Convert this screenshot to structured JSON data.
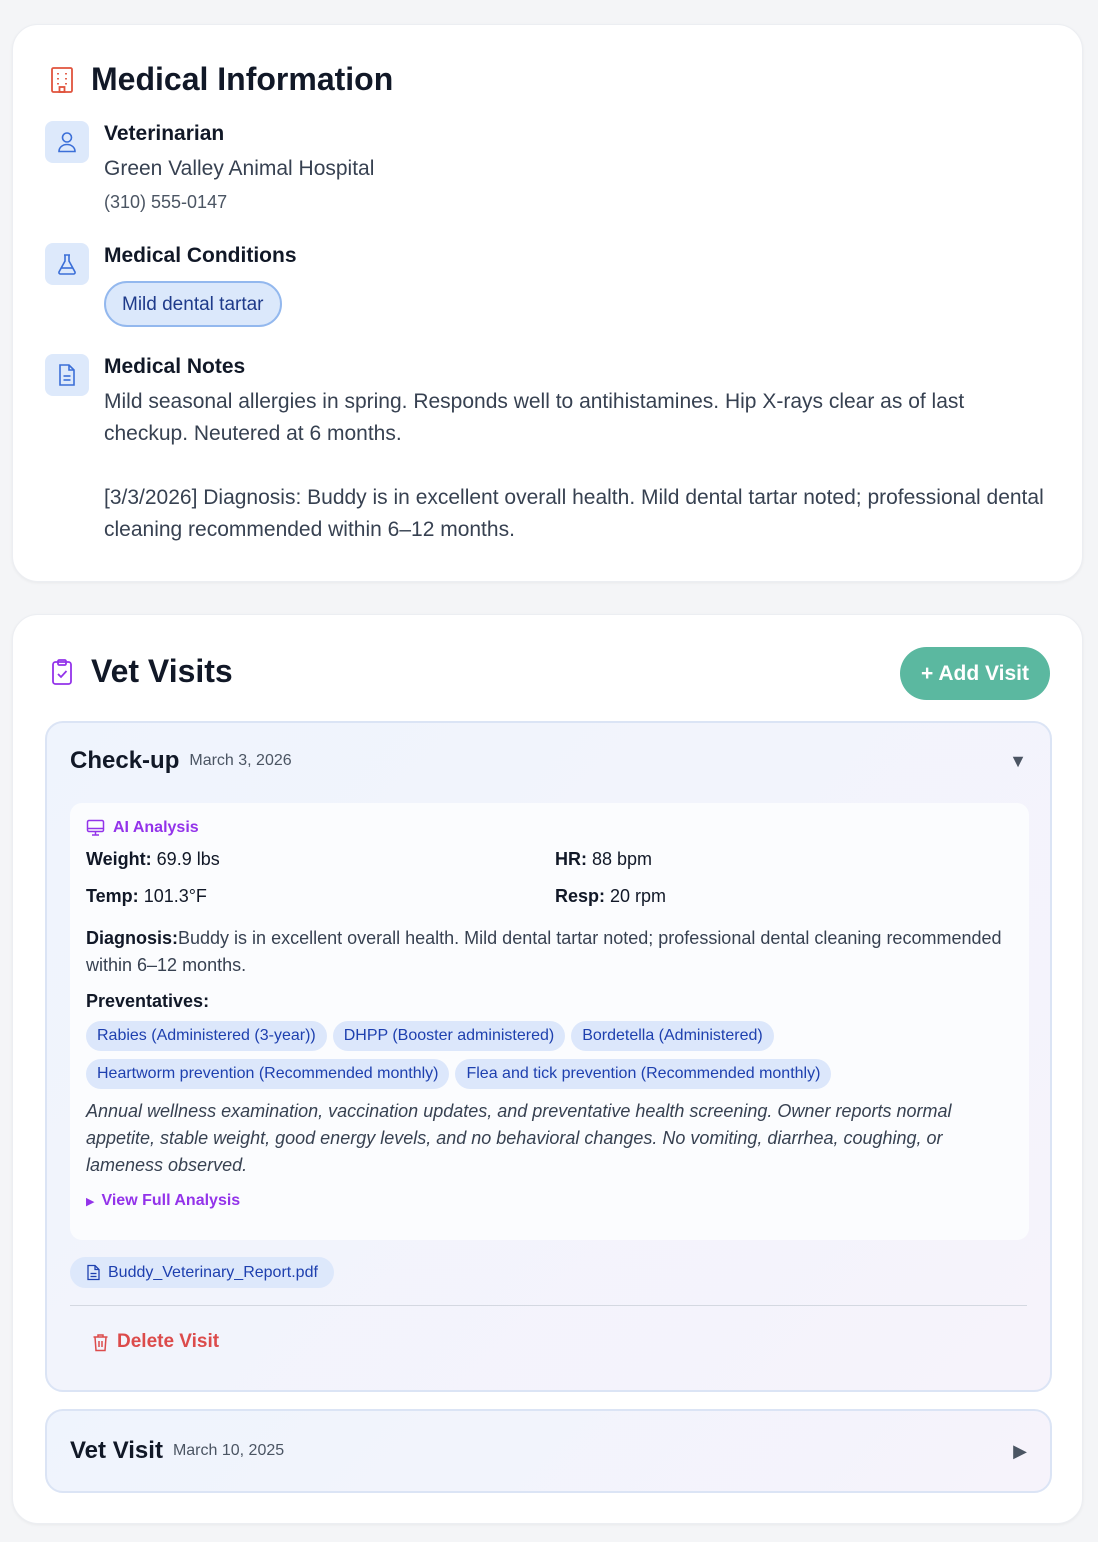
{
  "medical": {
    "title": "Medical Information",
    "veterinarian": {
      "label": "Veterinarian",
      "name": "Green Valley Animal Hospital",
      "phone": "(310) 555-0147"
    },
    "conditions": {
      "label": "Medical Conditions",
      "items": [
        "Mild dental tartar"
      ]
    },
    "notes": {
      "label": "Medical Notes",
      "paragraph1": "Mild seasonal allergies in spring. Responds well to antihistamines. Hip X-rays clear as of last checkup. Neutered at 6 months.",
      "paragraph2": "[3/3/2026] Diagnosis: Buddy is in excellent overall health. Mild dental tartar noted; professional dental cleaning recommended within 6–12 months."
    }
  },
  "visits": {
    "title": "Vet Visits",
    "add_label": "+ Add Visit",
    "items": [
      {
        "title": "Check-up",
        "date": "March 3, 2026",
        "expanded_indicator": "▼",
        "analysis": {
          "label": "AI Analysis",
          "weight_label": "Weight:",
          "weight": "69.9 lbs",
          "hr_label": "HR:",
          "hr": "88 bpm",
          "temp_label": "Temp:",
          "temp": "101.3°F",
          "resp_label": "Resp:",
          "resp": "20 rpm",
          "diagnosis_label": "Diagnosis:",
          "diagnosis": "Buddy is in excellent overall health. Mild dental tartar noted; professional dental cleaning recommended within 6–12 months.",
          "preventatives_label": "Preventatives:",
          "preventatives": [
            "Rabies (Administered (3-year))",
            "DHPP (Booster administered)",
            "Bordetella (Administered)",
            "Heartworm prevention (Recommended monthly)",
            "Flea and tick prevention (Recommended monthly)"
          ],
          "notes": "Annual wellness examination, vaccination updates, and preventative health screening. Owner reports normal appetite, stable weight, good energy levels, and no behavioral changes. No vomiting, diarrhea, coughing, or lameness observed.",
          "view_full_label": "View Full Analysis"
        },
        "file": "Buddy_Veterinary_Report.pdf",
        "delete_label": "Delete Visit"
      },
      {
        "title": "Vet Visit",
        "date": "March 10, 2025",
        "collapsed_indicator": "▶"
      }
    ]
  },
  "colors": {
    "accent_teal": "#5bb8a0",
    "accent_purple": "#9333ea",
    "danger": "#dc4b4b",
    "hospital_icon": "#e0533d"
  },
  "icons": [
    "hospital-icon",
    "user-icon",
    "flask-icon",
    "document-icon",
    "clipboard-check-icon",
    "monitor-icon",
    "file-icon",
    "trash-icon"
  ]
}
